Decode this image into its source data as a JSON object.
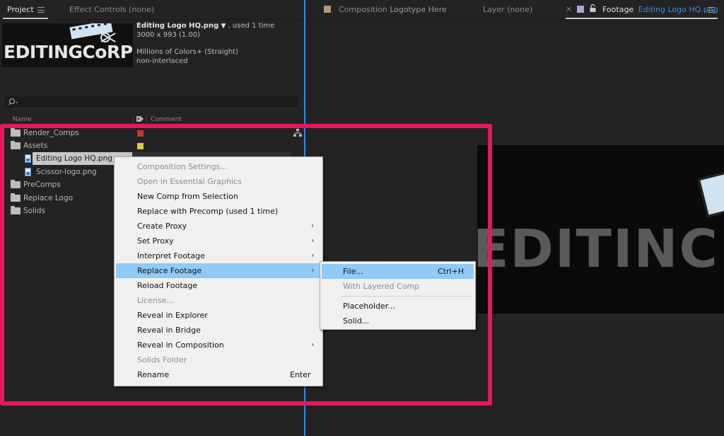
{
  "left_tabs": {
    "project": "Project",
    "effect_controls": "Effect Controls (none)"
  },
  "right_tabs": {
    "close": "×",
    "composition_prefix": "Composition",
    "composition_name": "Logotype Here",
    "layer": "Layer (none)",
    "footage_prefix": "Footage",
    "footage_name": "Editing Logo HQ.png"
  },
  "footage_info": {
    "filename": "Editing Logo HQ.png",
    "dropdown": "▼",
    "usage": ", used 1 time",
    "dimensions": "3000 x 993 (1.00)",
    "color": "Millions of Colors+ (Straight)",
    "interlace": "non-interlaced",
    "thumb_text": "EDITINGCoRP"
  },
  "search": {
    "icon": "search-icon",
    "placeholder": ""
  },
  "columns": {
    "name": "Name",
    "comment": "Comment",
    "label_icon": "tag-icon"
  },
  "tree": [
    {
      "name": "Render_Comps",
      "type": "folder",
      "twirl": "▸",
      "color": "#c0393d"
    },
    {
      "name": "Assets",
      "type": "folder",
      "twirl": "▾",
      "color": "#e0c83a"
    },
    {
      "name": "Editing Logo HQ.png",
      "type": "file",
      "selected": true
    },
    {
      "name": "Scissor-logo.png",
      "type": "file"
    },
    {
      "name": "PreComps",
      "type": "folder",
      "twirl": "▸"
    },
    {
      "name": "Replace Logo",
      "type": "folder",
      "twirl": "▸"
    },
    {
      "name": "Solids",
      "type": "folder",
      "twirl": "▸"
    }
  ],
  "viewer": {
    "logo_text": "EDITINC"
  },
  "context_menu": [
    {
      "label": "Composition Settings...",
      "disabled": true
    },
    {
      "label": "Open in Essential Graphics",
      "disabled": true
    },
    {
      "label": "New Comp from Selection"
    },
    {
      "label": "Replace with Precomp (used 1 time)"
    },
    {
      "label": "Create Proxy",
      "submenu": true
    },
    {
      "label": "Set Proxy",
      "submenu": true
    },
    {
      "label": "Interpret Footage",
      "submenu": true
    },
    {
      "label": "Replace Footage",
      "submenu": true,
      "highlighted": true
    },
    {
      "label": "Reload Footage"
    },
    {
      "label": "License...",
      "disabled": true
    },
    {
      "label": "Reveal in Explorer"
    },
    {
      "label": "Reveal in Bridge"
    },
    {
      "label": "Reveal in Composition",
      "submenu": true
    },
    {
      "label": "Solids Folder",
      "disabled": true
    },
    {
      "label": "Rename",
      "shortcut": "Enter"
    }
  ],
  "submenu": [
    {
      "label": "File...",
      "shortcut": "Ctrl+H",
      "highlighted": true
    },
    {
      "label": "With Layered Comp",
      "disabled": true
    },
    {
      "label": "Placeholder..."
    },
    {
      "label": "Solid..."
    }
  ],
  "colors": {
    "highlight_frame": "#e5195a",
    "menu_highlight": "#91c9f7",
    "panel_divider": "#2d8ceb"
  }
}
